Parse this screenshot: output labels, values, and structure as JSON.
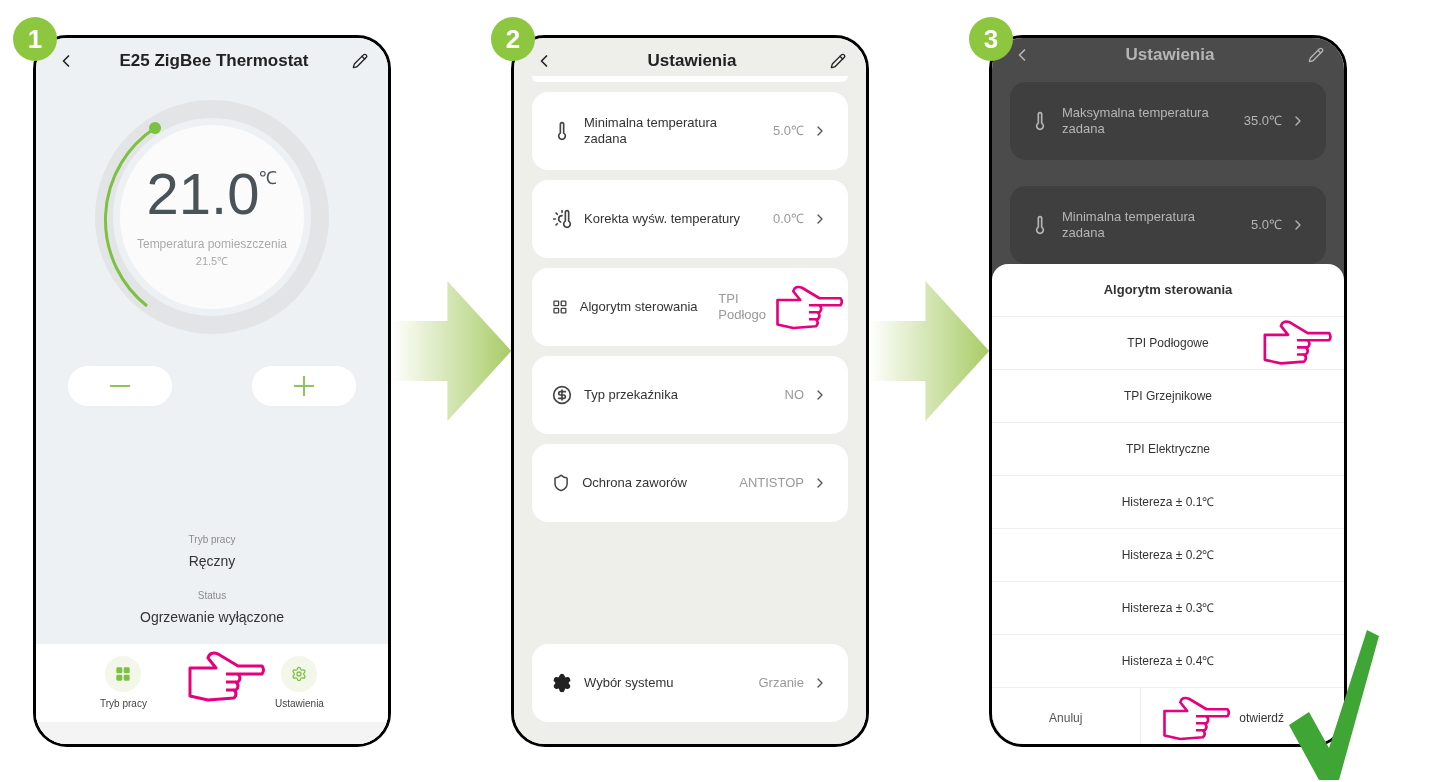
{
  "steps": [
    {
      "number": "1",
      "kind": "thermostat",
      "header": {
        "title": "E25 ZigBee Thermostat"
      },
      "dial": {
        "setpoint": "21.0",
        "unit": "℃",
        "room_label": "Temperatura pomieszczenia",
        "room_value": "21.5℃"
      },
      "info": [
        {
          "label": "Tryb pracy",
          "value": "Ręczny"
        },
        {
          "label": "Status",
          "value": "Ogrzewanie wyłączone"
        }
      ],
      "nav": [
        {
          "label": "Tryb pracy"
        },
        {
          "label": "Ustawienia"
        }
      ],
      "pointer": true
    },
    {
      "number": "2",
      "kind": "settings",
      "header": {
        "title": "Ustawienia"
      },
      "items": [
        {
          "label": "Minimalna temperatura zadana",
          "value": "5.0℃"
        },
        {
          "label": "Korekta wyśw. temperatury",
          "value": "0.0℃"
        },
        {
          "label": "Algorytm sterowania",
          "value": "TPI",
          "value_line2": "Podłogo",
          "pointer": true
        },
        {
          "label": "Typ przekaźnika",
          "value": "NO"
        },
        {
          "label": "Ochrona zaworów",
          "value": "ANTISTOP"
        }
      ],
      "footer_item": {
        "label": "Wybór systemu",
        "value": "Grzanie"
      }
    },
    {
      "number": "3",
      "kind": "picker",
      "header": {
        "title": "Ustawienia"
      },
      "items": [
        {
          "label": "Maksymalna temperatura zadana",
          "value": "35.0℃"
        },
        {
          "label": "Minimalna temperatura zadana",
          "value": "5.0℃"
        }
      ],
      "sheet": {
        "title": "Algorytm sterowania",
        "options": [
          {
            "label": "TPI Podłogowe",
            "pointer": true
          },
          {
            "label": "TPI Grzejnikowe",
            "pointer": false
          },
          {
            "label": "TPI Elektryczne",
            "pointer": false
          },
          {
            "label": "Histereza ± 0.1℃",
            "pointer": false
          },
          {
            "label": "Histereza ± 0.2℃",
            "pointer": false
          },
          {
            "label": "Histereza ± 0.3℃",
            "pointer": false
          },
          {
            "label": "Histereza ± 0.4℃",
            "pointer": false
          }
        ],
        "cancel": "Anuluj",
        "confirm": "otwierdź",
        "confirm_pointer": true
      },
      "done": true
    }
  ]
}
